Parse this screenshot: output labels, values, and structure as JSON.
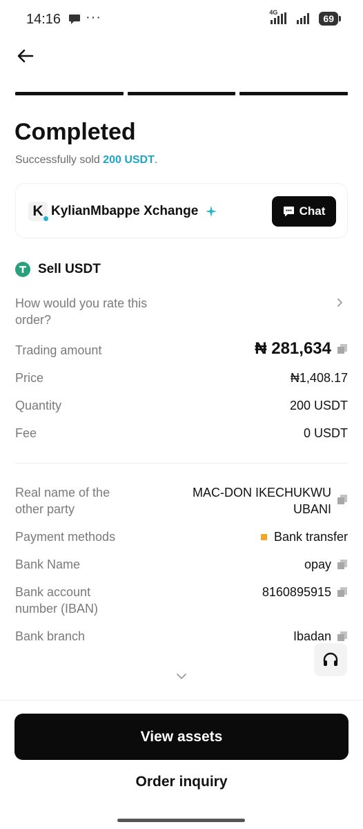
{
  "status_bar": {
    "time": "14:16",
    "dots": "···",
    "network": "4G",
    "battery": "69"
  },
  "header": {
    "title": "Completed",
    "subtitle_prefix": "Successfully sold ",
    "subtitle_amount": "200 USDT",
    "subtitle_suffix": "."
  },
  "merchant": {
    "avatar_letter": "K",
    "name": "KylianMbappe Xchange",
    "chat_label": "Chat"
  },
  "order": {
    "title": "Sell USDT",
    "rate_prompt": "How would you rate this order?",
    "trading_amount_label": "Trading amount",
    "trading_amount_value": "₦ 281,634",
    "price_label": "Price",
    "price_value": "₦1,408.17",
    "quantity_label": "Quantity",
    "quantity_value": "200 USDT",
    "fee_label": "Fee",
    "fee_value": "0 USDT"
  },
  "payment": {
    "real_name_label": "Real name of the other party",
    "real_name_value": "MAC-DON IKECHUKWU UBANI",
    "methods_label": "Payment methods",
    "methods_value": "Bank transfer",
    "bank_name_label": "Bank Name",
    "bank_name_value": "opay",
    "account_label": "Bank account number (IBAN)",
    "account_value": "8160895915",
    "branch_label": "Bank branch",
    "branch_value": "Ibadan"
  },
  "actions": {
    "primary": "View assets",
    "secondary": "Order inquiry"
  },
  "colors": {
    "accent": "#1aa6c4",
    "tether": "#26a17b",
    "bank_transfer": "#f5a623",
    "primary_button": "#0b0b0b"
  },
  "icons": [
    "back-arrow-icon",
    "chat-bubble-icon",
    "verified-sparkle-icon",
    "tether-icon",
    "chevron-right-icon",
    "copy-icon",
    "headset-icon",
    "chevron-down-icon"
  ]
}
